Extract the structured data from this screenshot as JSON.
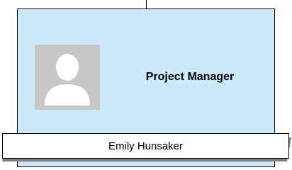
{
  "card": {
    "role": "Project Manager",
    "name": "Emily Hunsaker",
    "avatar_icon": "person-placeholder-icon"
  },
  "colors": {
    "card_fill": "#cce9fb",
    "avatar_bg": "#c7c7c7",
    "avatar_figure": "#ffffff"
  }
}
